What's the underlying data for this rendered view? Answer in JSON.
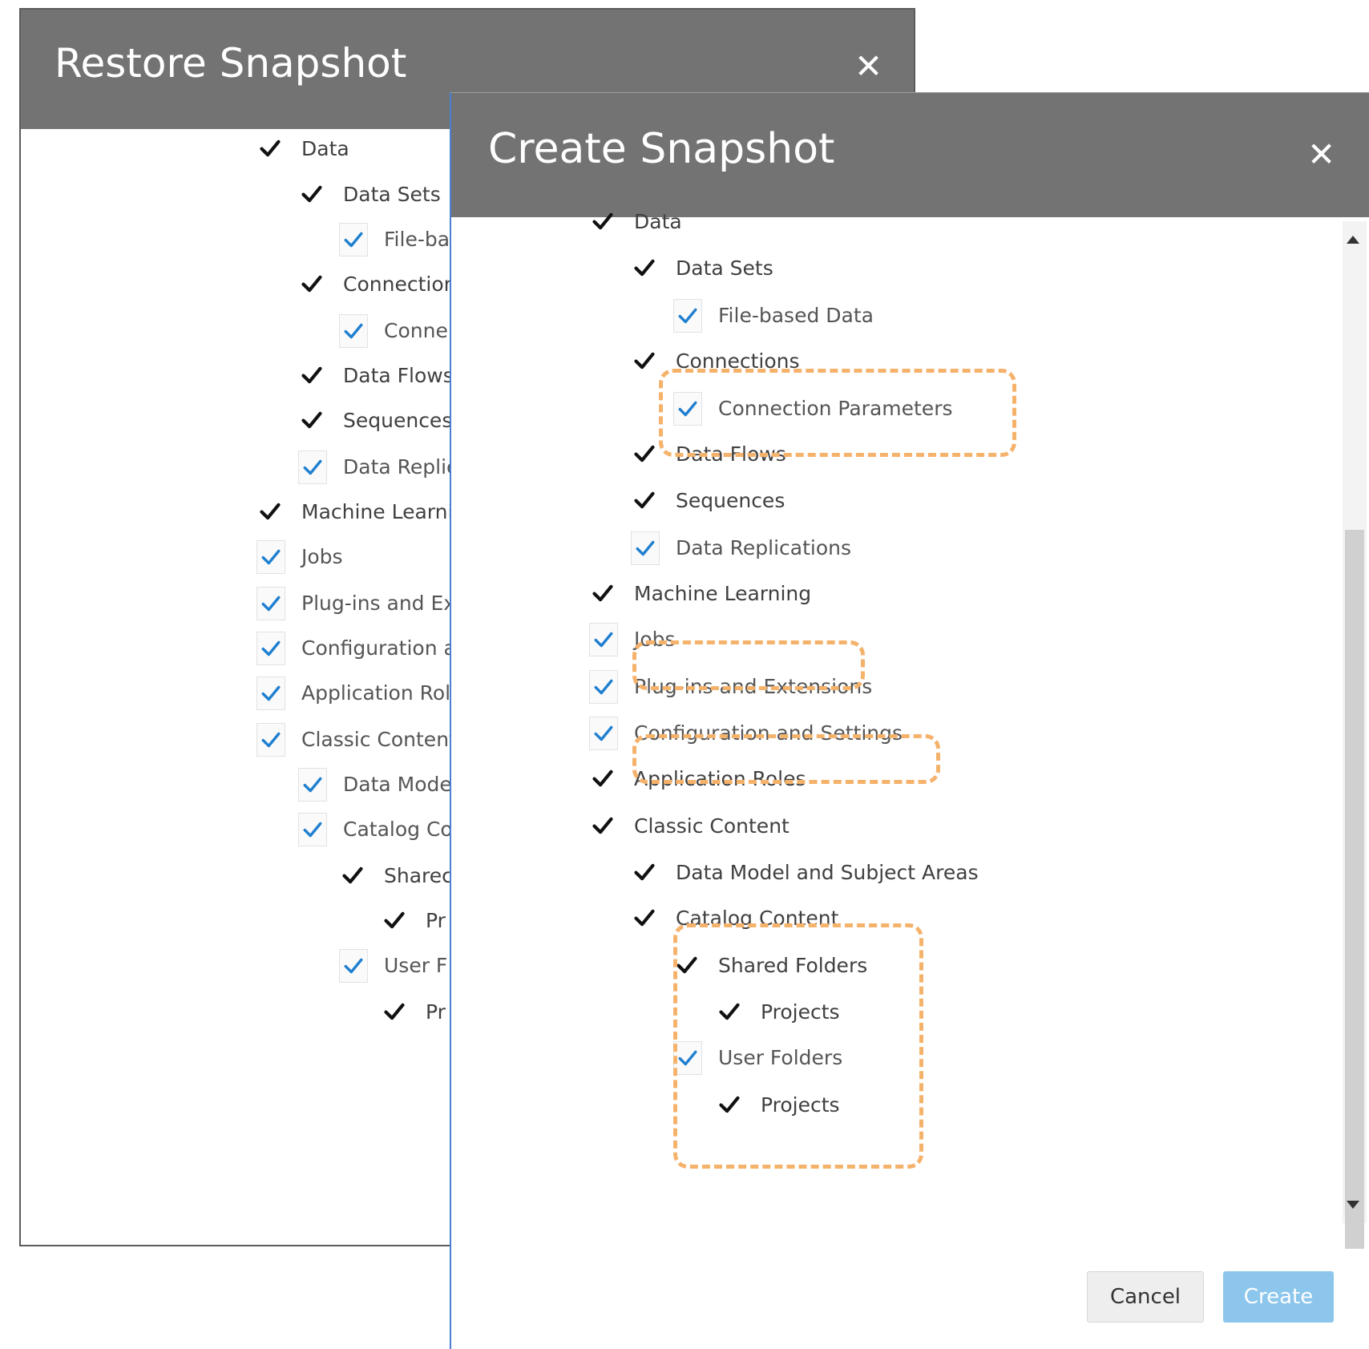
{
  "restore_dialog": {
    "title": "Restore Snapshot",
    "close_icon": "close-icon",
    "items": [
      {
        "label": "Data",
        "check": "black"
      },
      {
        "label": "Data Sets",
        "check": "black"
      },
      {
        "label": "File-ba",
        "check": "blue"
      },
      {
        "label": "Connection",
        "check": "black"
      },
      {
        "label": "Conne",
        "check": "blue"
      },
      {
        "label": "Data Flows",
        "check": "black"
      },
      {
        "label": "Sequences",
        "check": "black"
      },
      {
        "label": "Data Replic",
        "check": "blue"
      },
      {
        "label": "Machine Learnir",
        "check": "black"
      },
      {
        "label": "Jobs",
        "check": "blue"
      },
      {
        "label": "Plug-ins and Ext",
        "check": "blue"
      },
      {
        "label": "Configuration ar",
        "check": "blue"
      },
      {
        "label": "Application Role",
        "check": "blue"
      },
      {
        "label": "Classic Content",
        "check": "blue"
      },
      {
        "label": "Data Mode",
        "check": "blue"
      },
      {
        "label": "Catalog Co",
        "check": "blue"
      },
      {
        "label": "Sharec",
        "check": "black"
      },
      {
        "label": "Pr",
        "check": "black"
      },
      {
        "label": "User F",
        "check": "blue"
      },
      {
        "label": "Pr",
        "check": "black"
      }
    ]
  },
  "create_dialog": {
    "title": "Create Snapshot",
    "close_icon": "close-icon",
    "items": [
      {
        "label": "Data",
        "check": "black"
      },
      {
        "label": "Data Sets",
        "check": "black"
      },
      {
        "label": "File-based Data",
        "check": "blue"
      },
      {
        "label": "Connections",
        "check": "black"
      },
      {
        "label": "Connection Parameters",
        "check": "blue"
      },
      {
        "label": "Data Flows",
        "check": "black"
      },
      {
        "label": "Sequences",
        "check": "black"
      },
      {
        "label": "Data Replications",
        "check": "blue"
      },
      {
        "label": "Machine Learning",
        "check": "black"
      },
      {
        "label": "Jobs",
        "check": "blue"
      },
      {
        "label": "Plug-ins and Extensions",
        "check": "blue"
      },
      {
        "label": "Configuration and Settings",
        "check": "blue"
      },
      {
        "label": "Application Roles",
        "check": "black"
      },
      {
        "label": "Classic Content",
        "check": "black"
      },
      {
        "label": "Data Model and Subject Areas",
        "check": "black"
      },
      {
        "label": "Catalog Content",
        "check": "black"
      },
      {
        "label": "Shared Folders",
        "check": "black"
      },
      {
        "label": "Projects",
        "check": "black"
      },
      {
        "label": "User Folders",
        "check": "blue"
      },
      {
        "label": "Projects",
        "check": "black"
      }
    ],
    "buttons": {
      "cancel": "Cancel",
      "create": "Create"
    }
  },
  "colors": {
    "header": "#737373",
    "check_black": "#111111",
    "check_blue": "#1f7fd0",
    "highlight": "#f5b26b",
    "create_button": "#8cc6ec"
  }
}
